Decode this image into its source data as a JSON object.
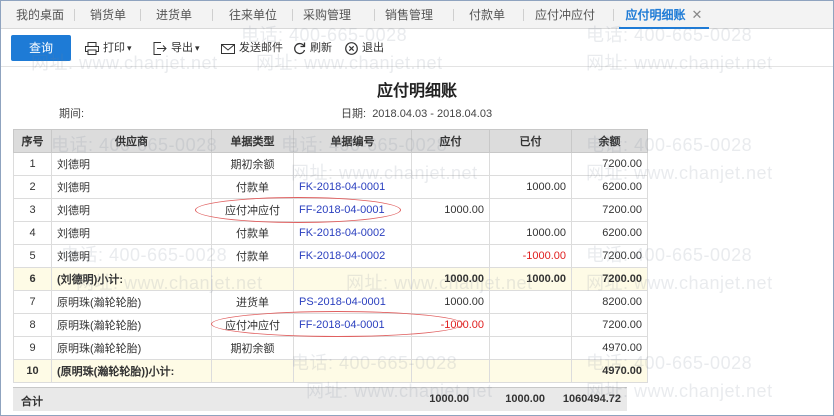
{
  "tabs": [
    {
      "label": "我的桌面"
    },
    {
      "label": "销货单"
    },
    {
      "label": "进货单"
    },
    {
      "label": "往来单位"
    },
    {
      "label": "采购管理"
    },
    {
      "label": "销售管理"
    },
    {
      "label": "付款单"
    },
    {
      "label": "应付冲应付"
    },
    {
      "label": "应付明细账",
      "active": true,
      "close": "✕"
    }
  ],
  "toolbar": {
    "query": "查询",
    "print": "打印",
    "export": "导出",
    "email": "发送邮件",
    "refresh": "刷新",
    "exit": "退出",
    "caret": "▾"
  },
  "report": {
    "title": "应付明细账",
    "period_label": "期间:",
    "date_label": "日期:",
    "date_value": "2018.04.03 - 2018.04.03"
  },
  "table": {
    "columns": [
      "序号",
      "供应商",
      "单据类型",
      "单据编号",
      "应付",
      "已付",
      "余额"
    ],
    "rows": [
      {
        "no": "1",
        "supplier": "刘德明",
        "type": "期初余额",
        "doc": "",
        "payable": "",
        "paid": "",
        "balance": "7200.00"
      },
      {
        "no": "2",
        "supplier": "刘德明",
        "type": "付款单",
        "doc": "FK-2018-04-0001",
        "payable": "",
        "paid": "1000.00",
        "balance": "6200.00"
      },
      {
        "no": "3",
        "supplier": "刘德明",
        "type": "应付冲应付",
        "doc": "FF-2018-04-0001",
        "payable": "1000.00",
        "paid": "",
        "balance": "7200.00"
      },
      {
        "no": "4",
        "supplier": "刘德明",
        "type": "付款单",
        "doc": "FK-2018-04-0002",
        "payable": "",
        "paid": "1000.00",
        "balance": "6200.00"
      },
      {
        "no": "5",
        "supplier": "刘德明",
        "type": "付款单",
        "doc": "FK-2018-04-0002",
        "payable": "",
        "paid": "-1000.00",
        "balance": "7200.00",
        "paid_neg": true
      },
      {
        "no": "6",
        "supplier": "(刘德明)小计:",
        "type": "",
        "doc": "",
        "payable": "1000.00",
        "paid": "1000.00",
        "balance": "7200.00",
        "subtotal": true
      },
      {
        "no": "7",
        "supplier": "原明珠(瀚轮轮胎)",
        "type": "进货单",
        "doc": "PS-2018-04-0001",
        "payable": "1000.00",
        "paid": "",
        "balance": "8200.00"
      },
      {
        "no": "8",
        "supplier": "原明珠(瀚轮轮胎)",
        "type": "应付冲应付",
        "doc": "FF-2018-04-0001",
        "payable": "-1000.00",
        "paid": "",
        "balance": "7200.00",
        "payable_neg": true
      },
      {
        "no": "9",
        "supplier": "原明珠(瀚轮轮胎)",
        "type": "期初余额",
        "doc": "",
        "payable": "",
        "paid": "",
        "balance": "4970.00"
      },
      {
        "no": "10",
        "supplier": "(原明珠(瀚轮轮胎))小计:",
        "type": "",
        "doc": "",
        "payable": "",
        "paid": "",
        "balance": "4970.00",
        "subtotal": true
      }
    ],
    "footer": {
      "label": "合计",
      "payable": "1000.00",
      "paid": "1000.00",
      "balance": "1060494.72"
    }
  },
  "watermark": {
    "phone": "电话: 400-665-0028",
    "site": "网址: www.chanjet.net"
  },
  "colors": {
    "accent": "#1e7bd6",
    "negative": "#e02020",
    "doc_link": "#2a3fbf",
    "subtotal_bg": "#fefbe6",
    "annotation": "#e06060"
  }
}
